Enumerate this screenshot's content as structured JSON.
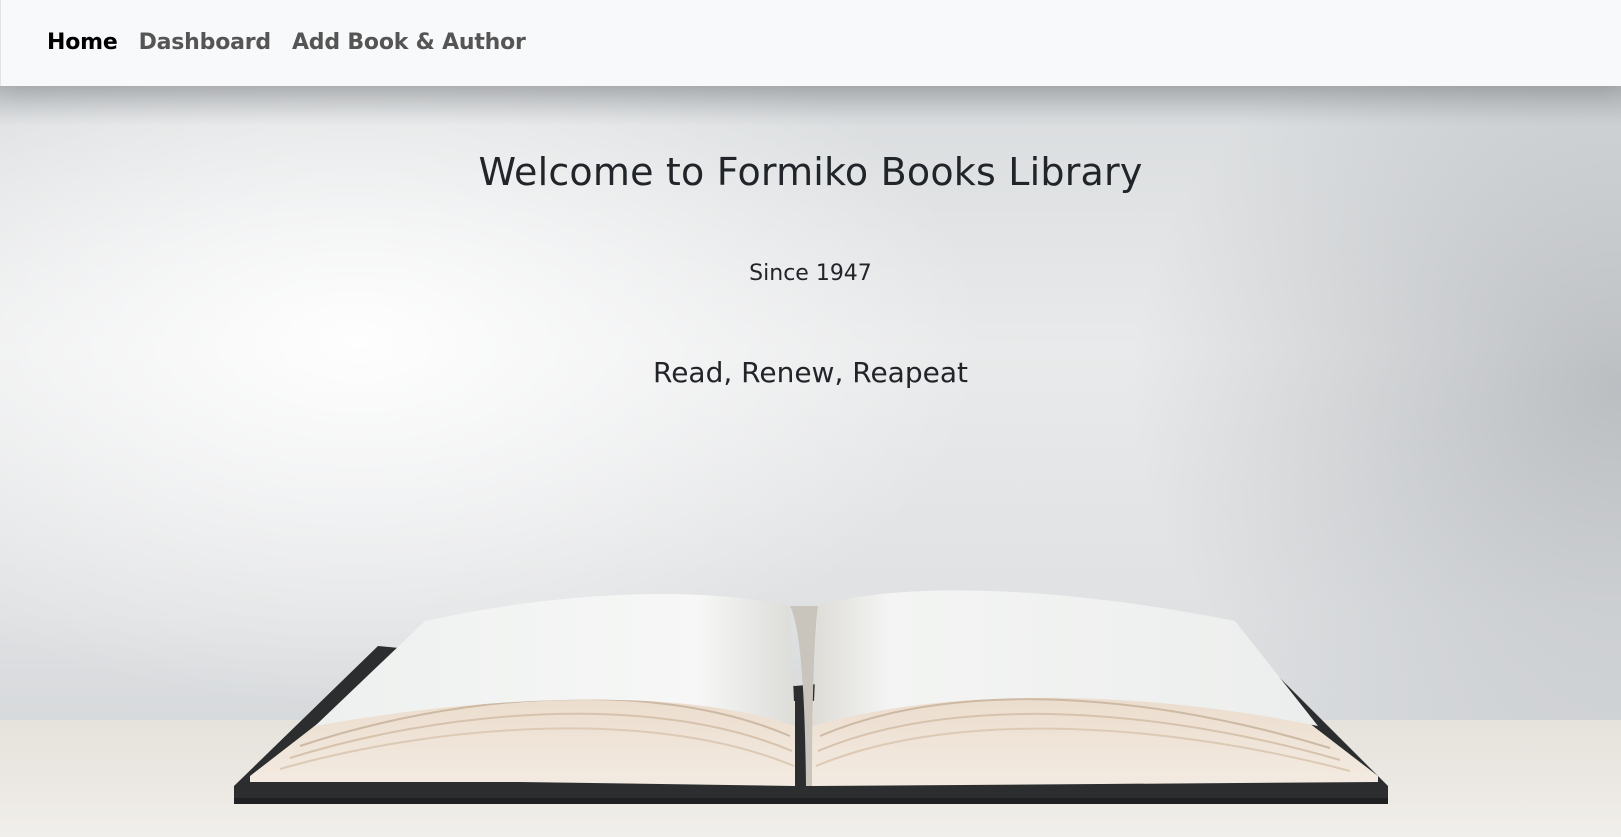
{
  "nav": {
    "items": [
      {
        "label": "Home",
        "active": true
      },
      {
        "label": "Dashboard",
        "active": false
      },
      {
        "label": "Add Book & Author",
        "active": false
      }
    ]
  },
  "hero": {
    "title": "Welcome to Formiko Books Library",
    "subtitle": "Since 1947",
    "tagline": "Read, Renew, Reapeat",
    "image": "open-book-on-table"
  },
  "colors": {
    "navbar_bg": "#f8f9fa",
    "nav_active": "#000000",
    "nav_inactive": "#555555",
    "text": "#212529"
  }
}
